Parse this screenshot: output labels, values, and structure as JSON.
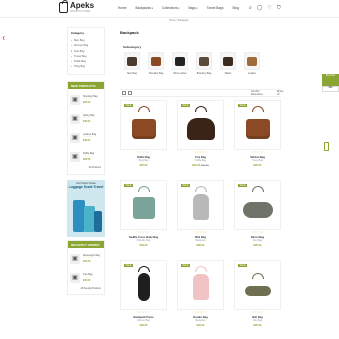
{
  "header": {
    "logo": "Apeks",
    "logo_sub": "FASHION STORE",
    "nav": [
      "Home",
      "Backpacks",
      "Collections",
      "Bags",
      "Travel Bags",
      "Blog"
    ],
    "icons": [
      "search-icon",
      "user-icon",
      "heart-icon",
      "cart-icon"
    ]
  },
  "breadcrumb": {
    "home": "Home",
    "sep": "/",
    "current": "Backpack"
  },
  "sidebar": {
    "category_title": "Category",
    "categories": [
      "Men Bag",
      "Women Bag",
      "Kids Bag",
      "Travel Bag",
      "Duffle Bag",
      "Sling Bag"
    ],
    "featured_title": "NEW PRODUCTS",
    "featured": [
      {
        "name": "Shoulder Bag",
        "price": "$25.00"
      },
      {
        "name": "Vanity Bag",
        "price": "$30.00"
      },
      {
        "name": "Leather Bag",
        "price": "$40.00"
      },
      {
        "name": "Duffle Bag",
        "price": "$35.00"
      }
    ],
    "featured_all": "All Products",
    "banner_sub": "Our Perfect Choice",
    "banner_title": "Luggage Scale Travel",
    "recent_title": "RECENTLY VIEWED",
    "recent": [
      {
        "name": "Messenger Bag",
        "price": "$25.00"
      },
      {
        "name": "Tote Bag",
        "price": "$30.00"
      }
    ],
    "recent_all": "All Special Products"
  },
  "main": {
    "title": "Backpack",
    "subcategory_title": "Subcategory",
    "subcategories": [
      "Men Bag",
      "Shoulder Bag",
      "Mini Leather",
      "Branding Bag",
      "Wallet",
      "Leather"
    ],
    "toolbar": {
      "sort": "Sort By: Relevance",
      "show": "Show: 12"
    },
    "sale_label": "SALE",
    "products": [
      {
        "name": "Duffel Bag",
        "cat": "Sling Bag",
        "price": "$25.00",
        "old": "",
        "stars": "☆☆☆☆☆",
        "color": "#8b4a24",
        "shape": "tote"
      },
      {
        "name": "Tote Bag",
        "cat": "Duffle Bag",
        "price": "$25.00",
        "old": "$30.00",
        "stars": "☆☆☆☆☆",
        "color": "#3a2418",
        "shape": "duffel"
      },
      {
        "name": "Satchel Bag",
        "cat": "Travel Bag",
        "price": "$29.00",
        "old": "",
        "stars": "☆☆☆☆☆",
        "color": "#8b4a24",
        "shape": "tote"
      },
      {
        "name": "Saddle Cross Body Bag",
        "cat": "Shoulder Bag",
        "price": "$33.00",
        "old": "",
        "stars": "☆☆☆☆☆",
        "color": "#7aa39a",
        "shape": "set"
      },
      {
        "name": "Mini Bag",
        "cat": "Backpack",
        "price": "$28.00",
        "old": "",
        "stars": "☆☆☆☆☆",
        "color": "#b9b9b9",
        "shape": "backpack"
      },
      {
        "name": "Barrel Bag",
        "cat": "Men Bag",
        "price": "$29.00",
        "old": "",
        "stars": "☆☆☆☆☆",
        "color": "#6f7468",
        "shape": "barrel"
      },
      {
        "name": "Backpack Purse",
        "cat": "Women Bag",
        "price": "$30.00",
        "old": "",
        "stars": "☆☆☆☆☆",
        "color": "#1f1f1f",
        "shape": "sling"
      },
      {
        "name": "Bowler Bag",
        "cat": "Backpack",
        "price": "$29.00",
        "old": "",
        "stars": "☆☆☆☆☆",
        "color": "#f0c4c4",
        "shape": "backpack"
      },
      {
        "name": "Belt Bag",
        "cat": "Kids Bag",
        "price": "$26.00",
        "old": "",
        "stars": "☆☆☆☆☆",
        "color": "#6f7052",
        "shape": "belt"
      }
    ]
  },
  "float": {
    "label": "Buy Now",
    "sub": "$39"
  }
}
